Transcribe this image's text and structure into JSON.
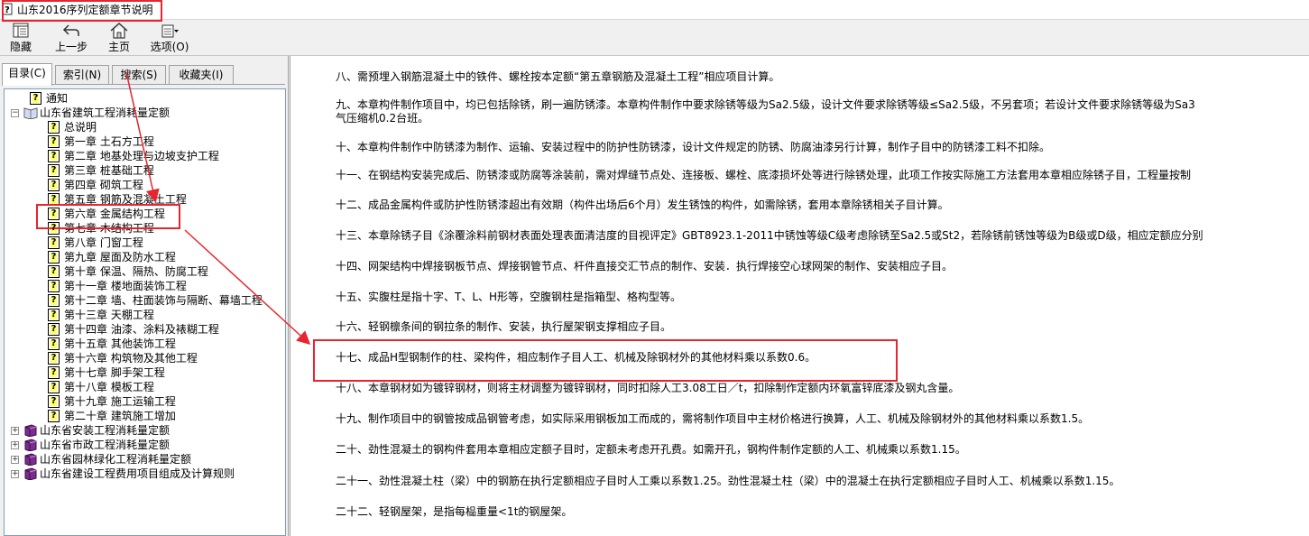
{
  "window": {
    "title": "山东2016序列定额章节说明"
  },
  "toolbar": {
    "buttons": [
      {
        "label": "隐藏",
        "icon": "hide-icon"
      },
      {
        "label": "上一步",
        "icon": "back-arrow-icon"
      },
      {
        "label": "主页",
        "icon": "home-icon"
      },
      {
        "label": "选项(O)",
        "icon": "options-icon"
      }
    ]
  },
  "tabs": [
    {
      "label": "目录(C)",
      "active": true
    },
    {
      "label": "索引(N)",
      "active": false
    },
    {
      "label": "搜索(S)",
      "active": false
    },
    {
      "label": "收藏夹(I)",
      "active": false
    }
  ],
  "tree": {
    "items": [
      {
        "label": "通知",
        "level": 1,
        "icon": "help-page-icon"
      },
      {
        "label": "山东省建筑工程消耗量定额",
        "level": 0,
        "icon": "open-book-icon",
        "expander": "−"
      },
      {
        "label": "总说明",
        "level": 2,
        "icon": "help-page-icon"
      },
      {
        "label": "第一章  土石方工程",
        "level": 2,
        "icon": "help-page-icon"
      },
      {
        "label": "第二章  地基处理与边坡支护工程",
        "level": 2,
        "icon": "help-page-icon"
      },
      {
        "label": "第三章  桩基础工程",
        "level": 2,
        "icon": "help-page-icon"
      },
      {
        "label": "第四章  砌筑工程",
        "level": 2,
        "icon": "help-page-icon"
      },
      {
        "label": "第五章  钢筋及混凝土工程",
        "level": 2,
        "icon": "help-page-icon"
      },
      {
        "label": "第六章  金属结构工程",
        "level": 2,
        "icon": "help-page-icon",
        "selected": true
      },
      {
        "label": "第七章  木结构工程",
        "level": 2,
        "icon": "help-page-icon"
      },
      {
        "label": "第八章  门窗工程",
        "level": 2,
        "icon": "help-page-icon"
      },
      {
        "label": "第九章  屋面及防水工程",
        "level": 2,
        "icon": "help-page-icon"
      },
      {
        "label": "第十章  保温、隔热、防腐工程",
        "level": 2,
        "icon": "help-page-icon"
      },
      {
        "label": "第十一章  楼地面装饰工程",
        "level": 2,
        "icon": "help-page-icon"
      },
      {
        "label": "第十二章  墙、柱面装饰与隔断、幕墙工程",
        "level": 2,
        "icon": "help-page-icon"
      },
      {
        "label": "第十三章  天棚工程",
        "level": 2,
        "icon": "help-page-icon"
      },
      {
        "label": "第十四章  油漆、涂料及裱糊工程",
        "level": 2,
        "icon": "help-page-icon"
      },
      {
        "label": "第十五章  其他装饰工程",
        "level": 2,
        "icon": "help-page-icon"
      },
      {
        "label": "第十六章  构筑物及其他工程",
        "level": 2,
        "icon": "help-page-icon"
      },
      {
        "label": "第十七章  脚手架工程",
        "level": 2,
        "icon": "help-page-icon"
      },
      {
        "label": "第十八章  模板工程",
        "level": 2,
        "icon": "help-page-icon"
      },
      {
        "label": "第十九章  施工运输工程",
        "level": 2,
        "icon": "help-page-icon"
      },
      {
        "label": "第二十章  建筑施工增加",
        "level": 2,
        "icon": "help-page-icon"
      },
      {
        "label": "山东省安装工程消耗量定额",
        "level": 0,
        "icon": "closed-book-icon",
        "expander": "+"
      },
      {
        "label": "山东省市政工程消耗量定额",
        "level": 0,
        "icon": "closed-book-icon",
        "expander": "+"
      },
      {
        "label": "山东省园林绿化工程消耗量定额",
        "level": 0,
        "icon": "closed-book-icon",
        "expander": "+"
      },
      {
        "label": "山东省建设工程费用项目组成及计算规则",
        "level": 0,
        "icon": "closed-book-icon",
        "expander": "+"
      }
    ]
  },
  "content": {
    "paragraphs": [
      "八、需预埋入钢筋混凝土中的铁件、螺栓按本定额“第五章钢筋及混凝土工程”相应项目计算。",
      "九、本章构件制作项目中，均已包括除锈，刷一遍防锈漆。本章构件制作中要求除锈等级为Sa2.5级，设计文件要求除锈等级≤Sa2.5级，不另套项；若设计文件要求除锈等级为Sa3",
      "气压缩机0.2台班。",
      "十、本章构件制作中防锈漆为制作、运输、安装过程中的防护性防锈漆，设计文件规定的防锈、防腐油漆另行计算，制作子目中的防锈漆工料不扣除。",
      "十一、在钢结构安装完成后、防锈漆或防腐等涂装前，需对焊缝节点处、连接板、螺栓、底漆损坏处等进行除锈处理，此项工作按实际施工方法套用本章相应除锈子目，工程量按制",
      "十二、成品金属构件或防护性防锈漆超出有效期（构件出场后6个月）发生锈蚀的构件，如需除锈，套用本章除锈相关子目计算。",
      "十三、本章除锈子目《涂覆涂料前钢材表面处理表面清洁度的目视评定》GBT8923.1-2011中锈蚀等级C级考虑除锈至Sa2.5或St2，若除锈前锈蚀等级为B级或D级，相应定额应分别",
      "十四、网架结构中焊接钢板节点、焊接钢管节点、杆件直接交汇节点的制作、安装．执行焊接空心球网架的制作、安装相应子目。",
      "十五、实腹柱是指十字、T、L、H形等，空腹钢柱是指箱型、格构型等。",
      "十六、轻钢檩条间的钢拉条的制作、安装，执行屋架钢支撑相应子目。",
      "十七、成品H型钢制作的柱、梁构件，相应制作子目人工、机械及除钢材外的其他材料乘以系数0.6。",
      "十八、本章钢材如为镀锌钢材，则将主材调整为镀锌钢材，同时扣除人工3.08工日／t，扣除制作定额内环氧富锌底漆及钢丸含量。",
      "十九、制作项目中的钢管按成品钢管考虑，如实际采用钢板加工而成的，需将制作项目中主材价格进行换算，人工、机械及除钢材外的其他材料乘以系数1.5。",
      "二十、劲性混凝土的钢构件套用本章相应定额子目时，定额未考虑开孔费。如需开孔，钢构件制作定额的人工、机械乘以系数1.15。",
      "二十一、劲性混凝土柱（梁）中的钢筋在执行定额相应子目时人工乘以系数1.25。劲性混凝土柱（梁）中的混凝土在执行定额相应子目时人工、机械乘以系数1.15。",
      "二十二、轻钢屋架，是指每榀重量<1t的钢屋架。"
    ]
  },
  "colors": {
    "annotation_red": "#e8242e",
    "tree_border": "#7f9db9"
  }
}
